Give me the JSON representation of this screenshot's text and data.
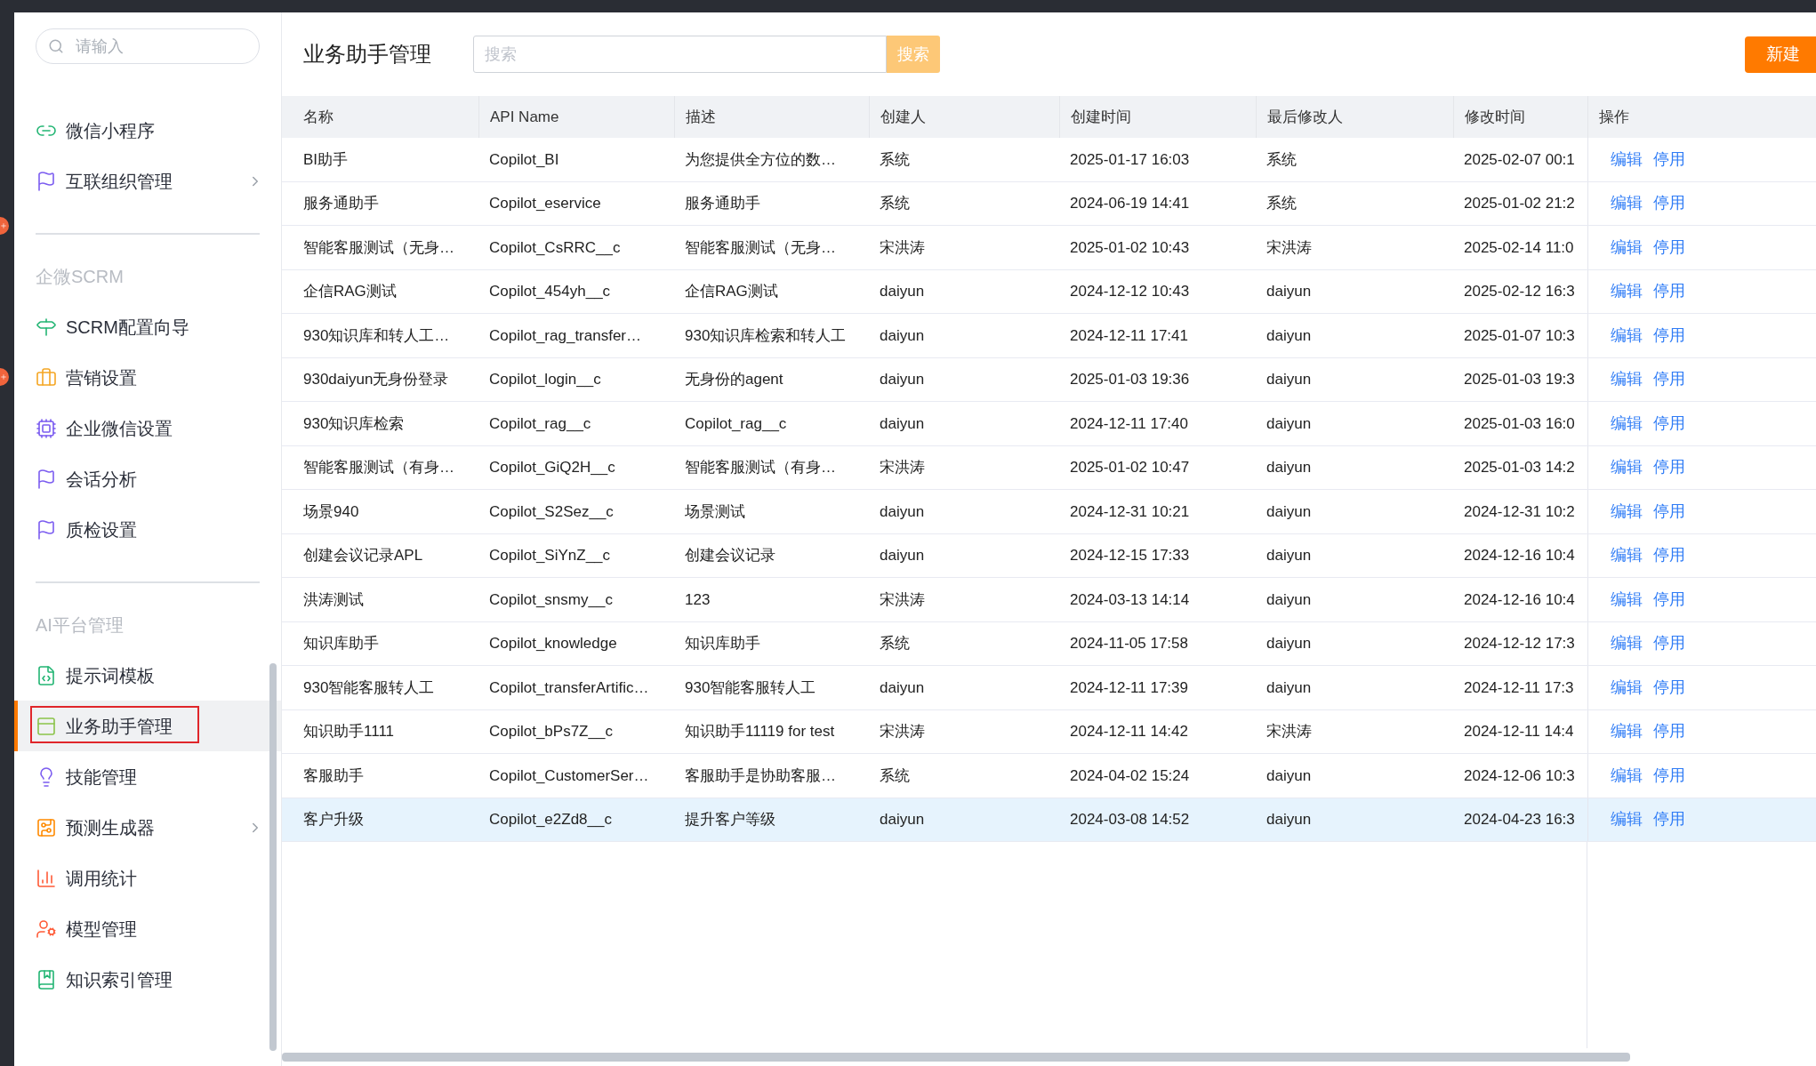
{
  "sidebar": {
    "search": {
      "placeholder": "请输入"
    },
    "sections": [
      {
        "items": [
          {
            "label": "微信小程序",
            "selected": false,
            "expandable": false
          },
          {
            "label": "互联组织管理",
            "selected": false,
            "expandable": true
          }
        ]
      },
      {
        "title": "企微SCRM",
        "items": [
          {
            "label": "SCRM配置向导",
            "selected": false,
            "expandable": false
          },
          {
            "label": "营销设置",
            "selected": false,
            "expandable": false
          },
          {
            "label": "企业微信设置",
            "selected": false,
            "expandable": false
          },
          {
            "label": "会话分析",
            "selected": false,
            "expandable": false
          },
          {
            "label": "质检设置",
            "selected": false,
            "expandable": false
          }
        ]
      },
      {
        "title": "AI平台管理",
        "items": [
          {
            "label": "提示词模板",
            "selected": false,
            "expandable": false
          },
          {
            "label": "业务助手管理",
            "selected": true,
            "expandable": false
          },
          {
            "label": "技能管理",
            "selected": false,
            "expandable": false
          },
          {
            "label": "预测生成器",
            "selected": false,
            "expandable": true
          },
          {
            "label": "调用统计",
            "selected": false,
            "expandable": false
          },
          {
            "label": "模型管理",
            "selected": false,
            "expandable": false
          },
          {
            "label": "知识索引管理",
            "selected": false,
            "expandable": false
          }
        ]
      }
    ]
  },
  "page": {
    "title": "业务助手管理",
    "search": {
      "placeholder": "搜索",
      "button": "搜索"
    },
    "new_button": "新建"
  },
  "table": {
    "columns": [
      "名称",
      "API Name",
      "描述",
      "创建人",
      "创建时间",
      "最后修改人",
      "修改时间",
      "操作"
    ],
    "rows": [
      {
        "cells": [
          "BI助手",
          "Copilot_BI",
          "为您提供全方位的数…",
          "系统",
          "2025-01-17 16:03",
          "系统",
          "2025-02-07 00:1"
        ],
        "actions": [
          "编辑",
          "停用"
        ],
        "selected": false
      },
      {
        "cells": [
          "服务通助手",
          "Copilot_eservice",
          "服务通助手",
          "系统",
          "2024-06-19 14:41",
          "系统",
          "2025-01-02 21:2"
        ],
        "actions": [
          "编辑",
          "停用"
        ],
        "selected": false
      },
      {
        "cells": [
          "智能客服测试（无身…",
          "Copilot_CsRRC__c",
          "智能客服测试（无身…",
          "宋洪涛",
          "2025-01-02 10:43",
          "宋洪涛",
          "2025-02-14 11:0"
        ],
        "actions": [
          "编辑",
          "停用"
        ],
        "selected": false
      },
      {
        "cells": [
          "企信RAG测试",
          "Copilot_454yh__c",
          "企信RAG测试",
          "daiyun",
          "2024-12-12 10:43",
          "daiyun",
          "2025-02-12 16:3"
        ],
        "actions": [
          "编辑",
          "停用"
        ],
        "selected": false
      },
      {
        "cells": [
          "930知识库和转人工…",
          "Copilot_rag_transfer…",
          "930知识库检索和转人工",
          "daiyun",
          "2024-12-11 17:41",
          "daiyun",
          "2025-01-07 10:3"
        ],
        "actions": [
          "编辑",
          "停用"
        ],
        "selected": false
      },
      {
        "cells": [
          "930daiyun无身份登录",
          "Copilot_login__c",
          "无身份的agent",
          "daiyun",
          "2025-01-03 19:36",
          "daiyun",
          "2025-01-03 19:3"
        ],
        "actions": [
          "编辑",
          "停用"
        ],
        "selected": false
      },
      {
        "cells": [
          "930知识库检索",
          "Copilot_rag__c",
          "Copilot_rag__c",
          "daiyun",
          "2024-12-11 17:40",
          "daiyun",
          "2025-01-03 16:0"
        ],
        "actions": [
          "编辑",
          "停用"
        ],
        "selected": false
      },
      {
        "cells": [
          "智能客服测试（有身…",
          "Copilot_GiQ2H__c",
          "智能客服测试（有身…",
          "宋洪涛",
          "2025-01-02 10:47",
          "daiyun",
          "2025-01-03 14:2"
        ],
        "actions": [
          "编辑",
          "停用"
        ],
        "selected": false
      },
      {
        "cells": [
          "场景940",
          "Copilot_S2Sez__c",
          "场景测试",
          "daiyun",
          "2024-12-31 10:21",
          "daiyun",
          "2024-12-31 10:2"
        ],
        "actions": [
          "编辑",
          "停用"
        ],
        "selected": false
      },
      {
        "cells": [
          "创建会议记录APL",
          "Copilot_SiYnZ__c",
          "创建会议记录",
          "daiyun",
          "2024-12-15 17:33",
          "daiyun",
          "2024-12-16 10:4"
        ],
        "actions": [
          "编辑",
          "停用"
        ],
        "selected": false
      },
      {
        "cells": [
          "洪涛测试",
          "Copilot_snsmy__c",
          "123",
          "宋洪涛",
          "2024-03-13 14:14",
          "daiyun",
          "2024-12-16 10:4"
        ],
        "actions": [
          "编辑",
          "停用"
        ],
        "selected": false
      },
      {
        "cells": [
          "知识库助手",
          "Copilot_knowledge",
          "知识库助手",
          "系统",
          "2024-11-05 17:58",
          "daiyun",
          "2024-12-12 17:3"
        ],
        "actions": [
          "编辑",
          "停用"
        ],
        "selected": false
      },
      {
        "cells": [
          "930智能客服转人工",
          "Copilot_transferArtific…",
          "930智能客服转人工",
          "daiyun",
          "2024-12-11 17:39",
          "daiyun",
          "2024-12-11 17:3"
        ],
        "actions": [
          "编辑",
          "停用"
        ],
        "selected": false
      },
      {
        "cells": [
          "知识助手1111",
          "Copilot_bPs7Z__c",
          "知识助手11119 for test",
          "宋洪涛",
          "2024-12-11 14:42",
          "宋洪涛",
          "2024-12-11 14:4"
        ],
        "actions": [
          "编辑",
          "停用"
        ],
        "selected": false
      },
      {
        "cells": [
          "客服助手",
          "Copilot_CustomerSer…",
          "客服助手是协助客服…",
          "系统",
          "2024-04-02 15:24",
          "daiyun",
          "2024-12-06 10:3"
        ],
        "actions": [
          "编辑",
          "停用"
        ],
        "selected": false
      },
      {
        "cells": [
          "客户升级",
          "Copilot_e2Zd8__c",
          "提升客户等级",
          "daiyun",
          "2024-03-08 14:52",
          "daiyun",
          "2024-04-23 16:3"
        ],
        "actions": [
          "编辑",
          "停用"
        ],
        "selected": true
      }
    ]
  }
}
